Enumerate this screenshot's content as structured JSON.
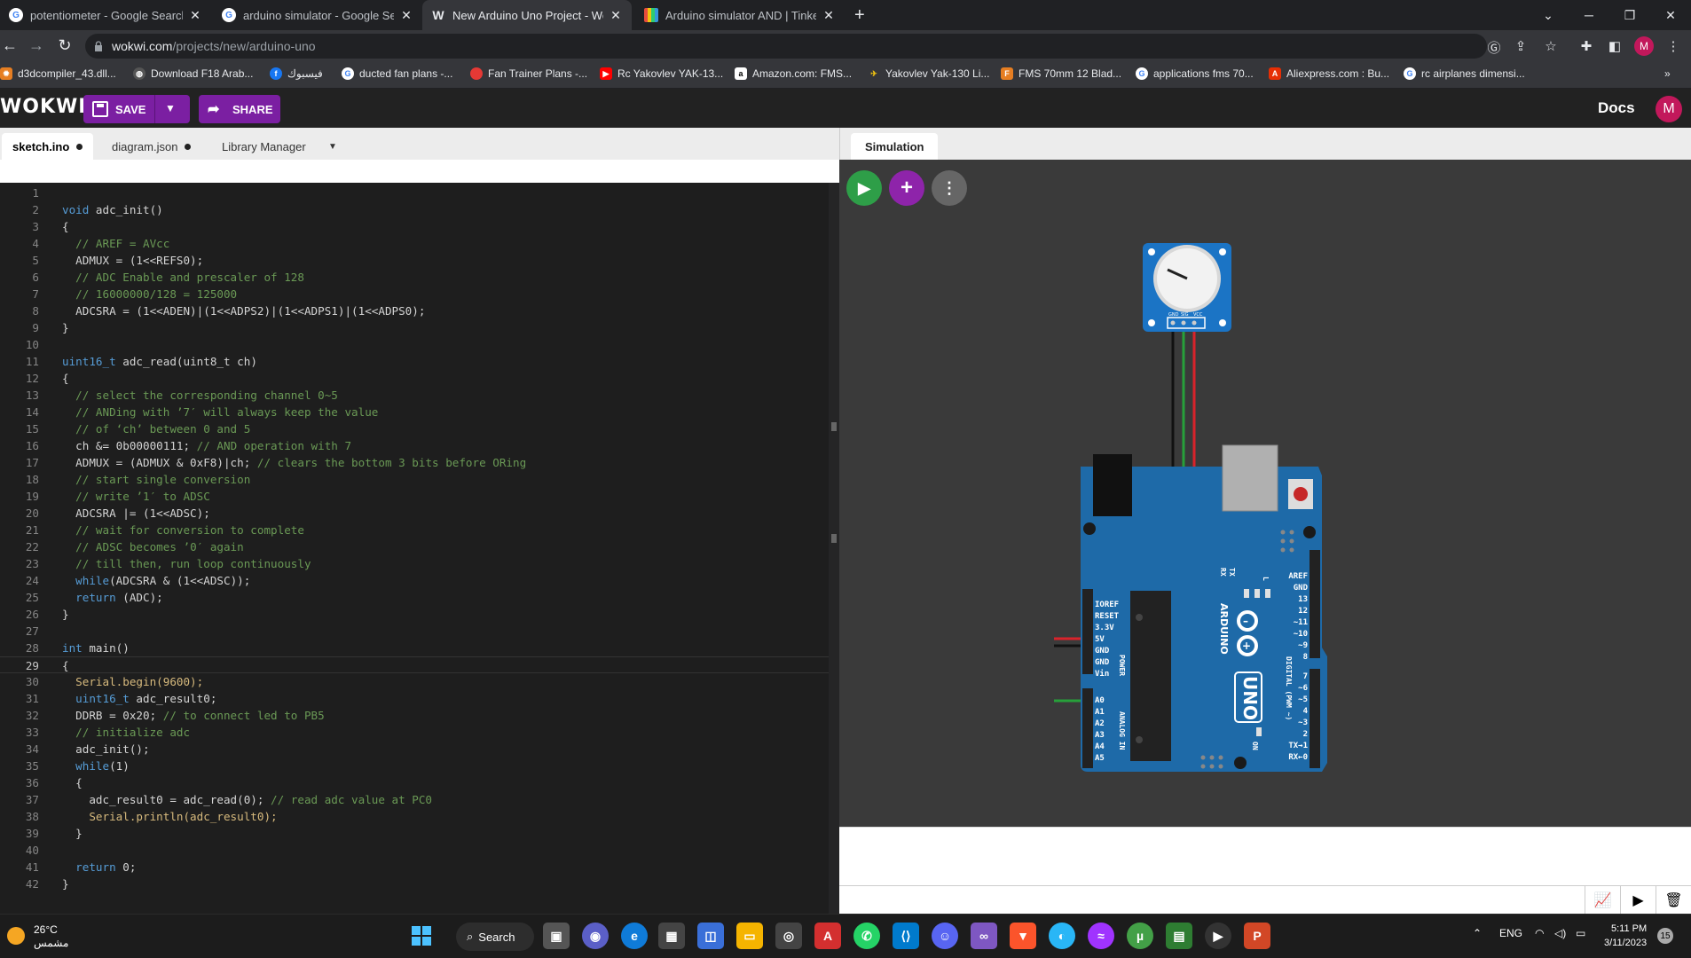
{
  "browser": {
    "tabs": [
      {
        "title": "potentiometer - Google Search",
        "icon": "google-icon"
      },
      {
        "title": "arduino simulator - Google Search",
        "icon": "google-icon"
      },
      {
        "title": "New Arduino Uno Project - Wokwi",
        "icon": "wokwi-icon"
      },
      {
        "title": "Arduino simulator AND | Tinkercad",
        "icon": "tinkercad-icon"
      }
    ],
    "url_host": "wokwi.com",
    "url_path": "/projects/new/arduino-uno",
    "profile_initial": "M",
    "bookmarks": [
      "d3dcompiler_43.dll...",
      "Download F18 Arab...",
      "فيسبوك",
      "ducted fan plans -...",
      "Fan Trainer Plans -...",
      "Rc Yakovlev YAK-13...",
      "Amazon.com: FMS...",
      "Yakovlev Yak-130 Li...",
      "FMS 70mm 12 Blad...",
      "applications fms 70...",
      "Aliexpress.com : Bu...",
      "rc airplanes dimensi..."
    ]
  },
  "wokwi": {
    "logo": "WOKWI",
    "save_label": "SAVE",
    "share_label": "SHARE",
    "docs_label": "Docs",
    "avatar_initial": "M",
    "editor_tabs": [
      "sketch.ino",
      "diagram.json",
      "Library Manager"
    ],
    "sim_tab": "Simulation"
  },
  "code_lines": [
    "",
    "void adc_init()",
    "{",
    "  // AREF = AVcc",
    "  ADMUX = (1<<REFS0);",
    "  // ADC Enable and prescaler of 128",
    "  // 16000000/128 = 125000",
    "  ADCSRA = (1<<ADEN)|(1<<ADPS2)|(1<<ADPS1)|(1<<ADPS0);",
    "}",
    "",
    "uint16_t adc_read(uint8_t ch)",
    "{",
    "  // select the corresponding channel 0~5",
    "  // ANDing with ’7′ will always keep the value",
    "  // of ‘ch’ between 0 and 5",
    "  ch &= 0b00000111; // AND operation with 7",
    "  ADMUX = (ADMUX & 0xF8)|ch; // clears the bottom 3 bits before ORing",
    "  // start single conversion",
    "  // write ’1′ to ADSC",
    "  ADCSRA |= (1<<ADSC);",
    "  // wait for conversion to complete",
    "  // ADSC becomes ’0′ again",
    "  // till then, run loop continuously",
    "  while(ADCSRA & (1<<ADSC));",
    "  return (ADC);",
    "}",
    "",
    "int main()",
    "{",
    "  Serial.begin(9600);",
    "  uint16_t adc_result0;",
    "  DDRB = 0x20; // to connect led to PB5",
    "  // initialize adc",
    "  adc_init();",
    "  while(1)",
    "  {",
    "    adc_result0 = adc_read(0); // read adc value at PC0",
    "    Serial.println(adc_result0);",
    "  }",
    "",
    "  return 0;",
    "}"
  ],
  "current_line": 29,
  "arduino": {
    "brand": "ARDUINO",
    "model": "UNO",
    "power_pins": [
      "IOREF",
      "RESET",
      "3.3V",
      "5V",
      "GND",
      "GND",
      "Vin"
    ],
    "analog_pins": [
      "A0",
      "A1",
      "A2",
      "A3",
      "A4",
      "A5"
    ],
    "digital_pins": [
      "AREF",
      "GND",
      "13",
      "12",
      "~11",
      "~10",
      "~9",
      "8",
      "7",
      "~6",
      "~5",
      "4",
      "~3",
      "2",
      "TX→1",
      "RX←0"
    ],
    "labels": [
      "POWER",
      "ANALOG IN",
      "DIGITAL (PWM ~)",
      "TX",
      "RX",
      "L",
      "ON"
    ],
    "pot_pins": [
      "GND",
      "SIG",
      "VCC"
    ]
  },
  "taskbar": {
    "temperature": "26°C",
    "weather": "مشمس",
    "search_label": "Search",
    "lang": "ENG",
    "time": "5:11 PM",
    "date": "3/11/2023",
    "notification_count": "15"
  },
  "colors": {
    "wokwi_purple": "#7b1fa2",
    "arduino_blue": "#1e6aa8",
    "pot_blue": "#1b74c5",
    "wire_red": "#d9232b",
    "wire_green": "#27a03a",
    "wire_black": "#111111"
  }
}
